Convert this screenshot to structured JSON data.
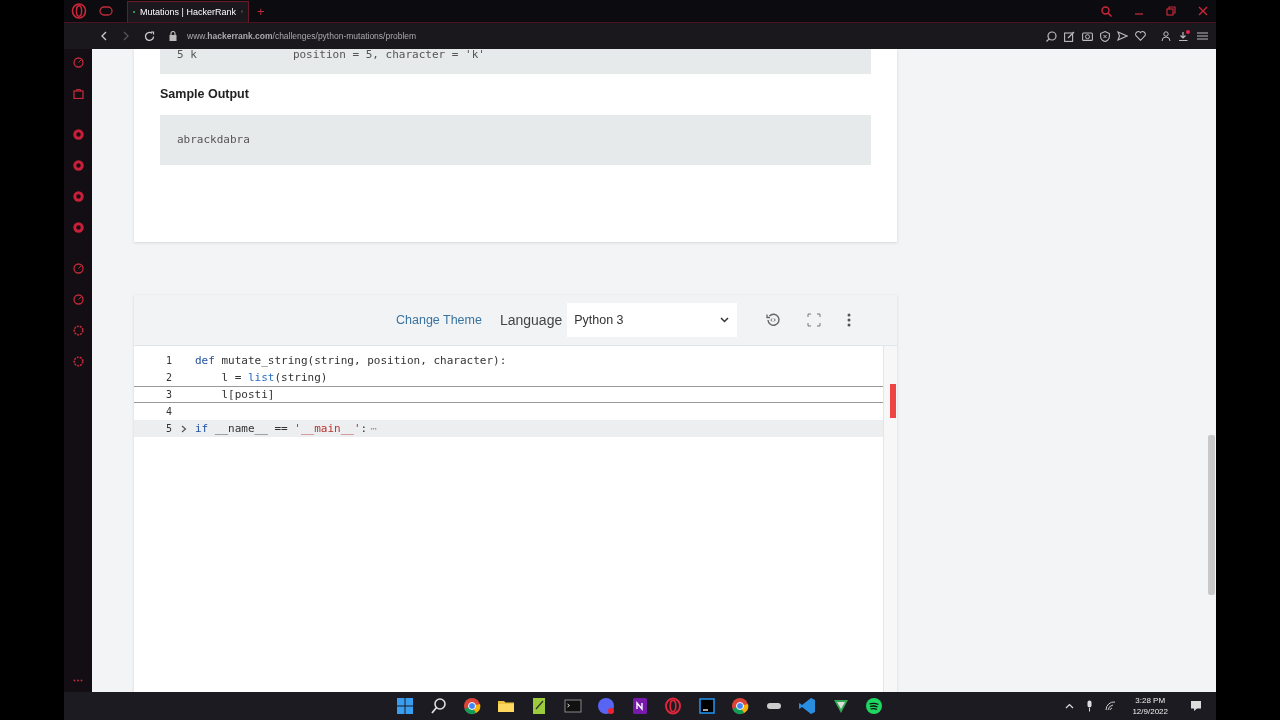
{
  "browser": {
    "tabs": [
      {
        "title": "Mutations | HackerRank",
        "selected": true
      }
    ],
    "new_tab": "+",
    "url": "www.**hackerrank.com**/challenges/python-mutations/problem"
  },
  "problem": {
    "sample_input_tail": [
      "5 k",
      "position = 5, character = 'k'"
    ],
    "sample_output_heading": "Sample Output",
    "sample_output": "abrackdabra"
  },
  "editor": {
    "change_theme": "Change Theme",
    "language_label": "Language",
    "language": "Python 3",
    "lines": [
      {
        "number": "1",
        "active": false,
        "folded": false,
        "tokens": [
          {
            "text": "def",
            "kind": "keyword"
          },
          {
            "text": " mutate_string(string, position, character):",
            "kind": "plain"
          }
        ]
      },
      {
        "number": "2",
        "active": false,
        "folded": false,
        "tokens": [
          {
            "text": "    l = ",
            "kind": "plain"
          },
          {
            "text": "list",
            "kind": "builtin"
          },
          {
            "text": "(string)",
            "kind": "plain"
          }
        ]
      },
      {
        "number": "3",
        "active": true,
        "folded": false,
        "tokens": [
          {
            "text": "    l[posti]",
            "kind": "plain"
          }
        ]
      },
      {
        "number": "4",
        "active": false,
        "folded": false
      },
      {
        "number": "5",
        "active": false,
        "folded": true,
        "tokens": [
          {
            "text": "if",
            "kind": "keyword"
          },
          {
            "text": " __name__ == ",
            "kind": "plain"
          },
          {
            "text": "'__main__'",
            "kind": "string"
          },
          {
            "text": ":",
            "kind": "plain"
          }
        ],
        "fold_mark": "⋯"
      }
    ]
  },
  "taskbar": {
    "time": "3:28 PM",
    "date": "12/9/2022"
  }
}
